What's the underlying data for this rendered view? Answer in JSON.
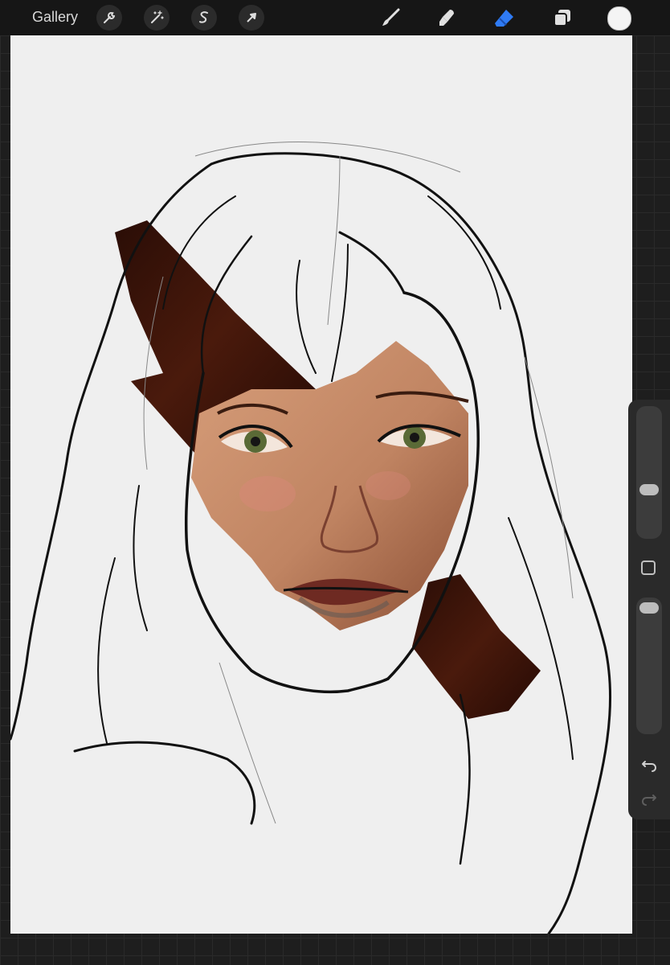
{
  "toolbar": {
    "gallery_label": "Gallery",
    "left_tools": [
      {
        "name": "actions",
        "icon": "wrench-icon"
      },
      {
        "name": "adjustments",
        "icon": "magic-wand-icon"
      },
      {
        "name": "selection",
        "icon": "selection-s-icon"
      },
      {
        "name": "transform",
        "icon": "arrow-cursor-icon"
      }
    ],
    "right_tools": [
      {
        "name": "brush",
        "icon": "brush-icon",
        "active": false
      },
      {
        "name": "smudge",
        "icon": "smudge-icon",
        "active": false
      },
      {
        "name": "eraser",
        "icon": "eraser-icon",
        "active": true
      },
      {
        "name": "layers",
        "icon": "layers-icon",
        "active": false
      }
    ],
    "active_tool": "eraser",
    "active_color": "#f4f4f4",
    "accent_color": "#2f7bf5"
  },
  "sidebar": {
    "brush_size_level": 0.55,
    "opacity_level": 1.0,
    "modify_icon": "square-icon",
    "undo_icon": "undo-icon",
    "redo_icon": "redo-icon"
  },
  "canvas": {
    "background": "#efefef",
    "artwork": "portrait-sketch-with-painted-skin-stroke",
    "colors": {
      "skin_light": "#d9a37f",
      "skin_mid": "#b87a58",
      "hair_dark": "#3a160c",
      "iris": "#5a6a36",
      "lip": "#6e2a22",
      "line": "#111111"
    }
  }
}
